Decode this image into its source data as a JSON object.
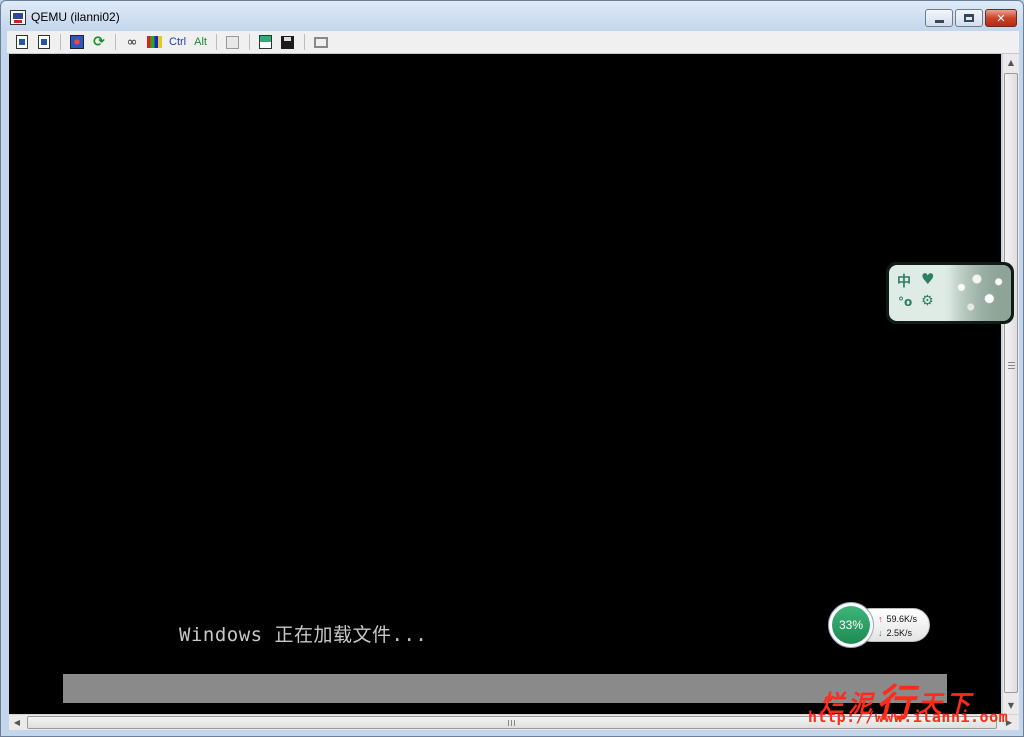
{
  "window": {
    "title": "QEMU (ilanni02)",
    "controls": {
      "minimize": "minimize",
      "maximize": "maximize",
      "close": "close"
    }
  },
  "toolbar": {
    "items": [
      {
        "name": "properties",
        "icon": "properties-icon"
      },
      {
        "name": "info",
        "icon": "info-icon"
      },
      {
        "name": "network",
        "icon": "network-icon"
      },
      {
        "name": "refresh",
        "icon": "refresh-icon"
      },
      {
        "name": "link",
        "icon": "link-icon"
      },
      {
        "name": "keyboard",
        "icon": "flag-icon"
      },
      {
        "name": "ctrl",
        "label": "Ctrl"
      },
      {
        "name": "alt",
        "label": "Alt"
      },
      {
        "name": "copy",
        "icon": "copy-icon"
      },
      {
        "name": "paste",
        "icon": "paste-icon"
      },
      {
        "name": "save",
        "icon": "save-icon"
      },
      {
        "name": "fullscreen",
        "icon": "frame-icon"
      }
    ],
    "ctrl_label": "Ctrl",
    "alt_label": "Alt"
  },
  "screen": {
    "loading_text": "Windows 正在加载文件...",
    "background": "#000000",
    "progress_bar_color": "#8a8a8a"
  },
  "ime": {
    "mode_label": "中",
    "heart_icon": "heart-icon",
    "half_width_label": "°o",
    "settings_icon": "gear-icon"
  },
  "network_widget": {
    "percent": "33%",
    "upload_speed": "59.6K/s",
    "download_speed": "2.5K/s",
    "accent": "#2a9d64"
  },
  "watermark": {
    "text_prefix": "烂泥",
    "text_big": "行",
    "text_suffix": "天下",
    "url": "http://www.ilanni.oom",
    "color": "#ff2a1a"
  }
}
